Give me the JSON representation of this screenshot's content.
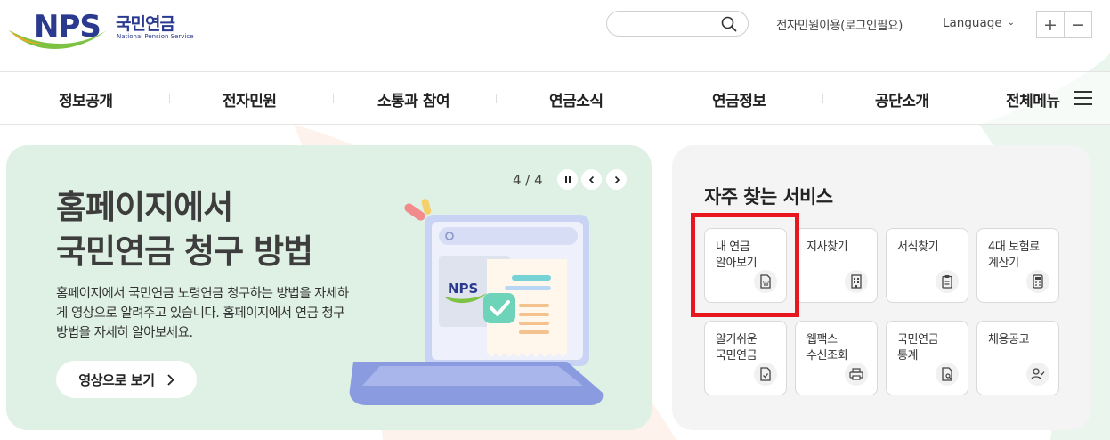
{
  "header": {
    "logo": {
      "mark": "NPS",
      "name_kr": "국민연금",
      "name_en": "National Pension Service"
    },
    "search": {
      "placeholder": "",
      "value": ""
    },
    "civil_service_link": "전자민원이용(로그인필요)",
    "language_label": "Language",
    "zoom": {
      "in": "+",
      "out": "−"
    }
  },
  "nav": {
    "items": [
      "정보공개",
      "전자민원",
      "소통과 참여",
      "연금소식",
      "연금정보",
      "공단소개"
    ],
    "all_menu": "전체메뉴"
  },
  "banner": {
    "title_line1": "홈페이지에서",
    "title_line2": "국민연금 청구 방법",
    "description": "홈페이지에서 국민연금 노령연금 청구하는 방법을 자세하게 영상으로 알려주고 있습니다. 홈페이지에서 연금 청구방법을 자세히 알아보세요.",
    "button_label": "영상으로 보기",
    "slide_counter": "4 / 4",
    "screen_logo": "NPS"
  },
  "services": {
    "title": "자주 찾는 서비스",
    "tiles": [
      {
        "label": "내 연금\n알아보기",
        "icon": "pension-doc-icon",
        "highlighted": true
      },
      {
        "label": "지사찾기",
        "icon": "building-icon"
      },
      {
        "label": "서식찾기",
        "icon": "clipboard-icon"
      },
      {
        "label": "4대 보험료\n계산기",
        "icon": "calculator-icon"
      },
      {
        "label": "알기쉬운\n국민연금",
        "icon": "check-doc-icon"
      },
      {
        "label": "웹팩스\n수신조회",
        "icon": "printer-icon"
      },
      {
        "label": "국민연금\n통계",
        "icon": "doc-search-icon"
      },
      {
        "label": "채용공고",
        "icon": "person-check-icon"
      }
    ]
  },
  "colors": {
    "brand_navy": "#2b3a8f",
    "brand_green": "#7dc242",
    "brand_orange": "#f5a623",
    "banner_bg": "#dff0e5",
    "services_bg": "#f4f4f4",
    "highlight": "#e8161d"
  }
}
